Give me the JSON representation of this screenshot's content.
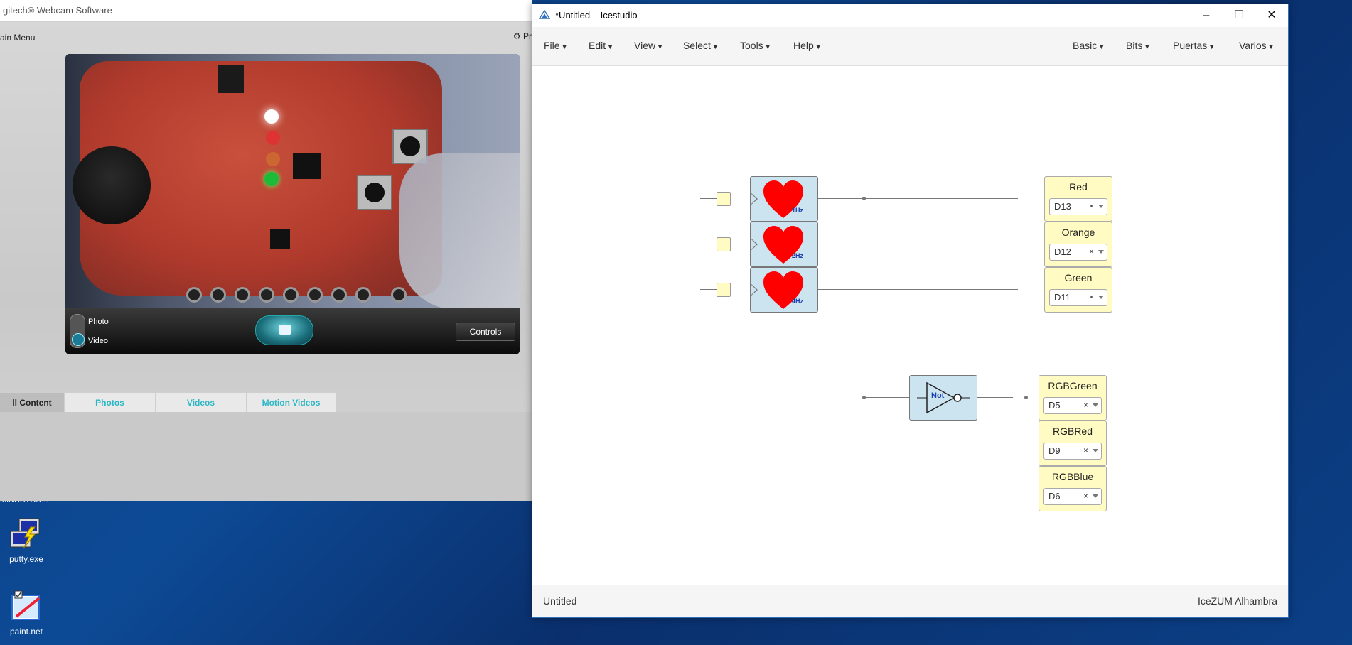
{
  "webcam": {
    "title": "gitech® Webcam Software",
    "main_menu": "ain Menu",
    "prefs": "Pr",
    "photo_label": "Photo",
    "video_label": "Video",
    "controls_label": "Controls",
    "tabs": [
      "ll Content",
      "Photos",
      "Videos",
      "Motion Videos"
    ]
  },
  "desktop": {
    "truncated_label": "MINDSTOR...",
    "icons": [
      {
        "label": "putty.exe",
        "icon": "putty-icon"
      },
      {
        "label": "paint.net",
        "icon": "paintnet-icon"
      }
    ]
  },
  "icestudio": {
    "title": "*Untitled – Icestudio",
    "menus_left": [
      "File",
      "Edit",
      "View",
      "Select",
      "Tools",
      "Help"
    ],
    "menus_right": [
      "Basic",
      "Bits",
      "Puertas",
      "Varios"
    ],
    "status_left": "Untitled",
    "status_right": "IceZUM Alhambra",
    "clocks": [
      "1Hz",
      "2Hz",
      "4Hz"
    ],
    "not_label": "Not",
    "outputs": [
      {
        "name": "Red",
        "pin": "D13"
      },
      {
        "name": "Orange",
        "pin": "D12"
      },
      {
        "name": "Green",
        "pin": "D11"
      },
      {
        "name": "RGBGreen",
        "pin": "D5"
      },
      {
        "name": "RGBRed",
        "pin": "D9"
      },
      {
        "name": "RGBBlue",
        "pin": "D6"
      }
    ],
    "remove_glyph": "×"
  },
  "colors": {
    "ice_block_blue": "#cce4ef",
    "ice_io_yellow": "#fffbc2",
    "heart_red": "#ff0000",
    "webcam_tab_accent": "#2ab7c4"
  }
}
